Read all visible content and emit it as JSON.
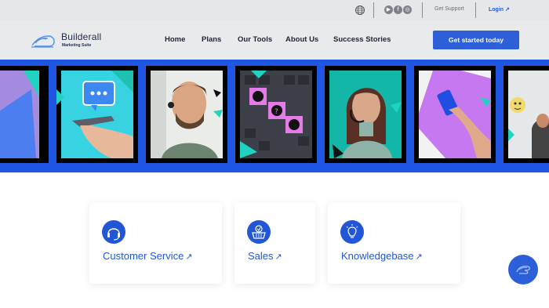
{
  "topbar": {
    "support_label": "Get Support",
    "login_label": "Login ↗"
  },
  "header": {
    "brand_name": "Builderall",
    "brand_sub": "Marketing Suite",
    "nav": [
      "Home",
      "Plans",
      "Our Tools",
      "About Us",
      "Success Stories"
    ],
    "cta_label": "Get started today"
  },
  "cards": [
    {
      "title": "Customer Service",
      "arrow": "↗",
      "icon": "headset-icon"
    },
    {
      "title": "Sales",
      "arrow": "↗",
      "icon": "basket-icon"
    },
    {
      "title": "Knowledgebase",
      "arrow": "↗",
      "icon": "lightbulb-icon"
    }
  ],
  "colors": {
    "primary": "#2157d6",
    "banner": "#1f55e3",
    "teal": "#1fd3c0"
  }
}
